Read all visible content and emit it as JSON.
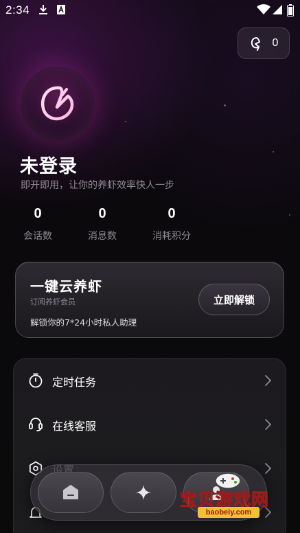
{
  "status_bar": {
    "time": "2:34",
    "icons": [
      "download-icon",
      "a-badge-icon",
      "wifi-icon",
      "signal-icon",
      "battery-icon"
    ]
  },
  "points": {
    "value": "0",
    "icon": "shrimp-coin-icon"
  },
  "profile": {
    "avatar_icon": "shrimp-logo-icon",
    "name": "未登录",
    "subtitle": "即开即用，让你的养虾效率快人一步"
  },
  "stats": [
    {
      "value": "0",
      "label": "会话数"
    },
    {
      "value": "0",
      "label": "消息数"
    },
    {
      "value": "0",
      "label": "消耗积分"
    }
  ],
  "promo": {
    "title": "一键云养虾",
    "subtitle": "订阅养虾会员",
    "description": "解锁你的7*24小时私人助理",
    "button_label": "立即解锁"
  },
  "menu": {
    "items": [
      {
        "label": "定时任务",
        "icon": "timer-icon"
      },
      {
        "label": "在线客服",
        "icon": "headset-icon"
      },
      {
        "label": "设置",
        "icon": "settings-icon"
      },
      {
        "label": "",
        "icon": "bell-icon"
      }
    ]
  },
  "bottom_nav": {
    "tabs": [
      {
        "icon": "home-icon"
      },
      {
        "icon": "sparkle-icon"
      },
      {
        "icon": "profile-icon"
      }
    ]
  },
  "watermark": {
    "text": "宝贝游戏网",
    "url": "baobeiy.com"
  },
  "colors": {
    "background": "#0b090c",
    "accent_glow": "#aa2896",
    "watermark_yellow": "#ffd23a"
  }
}
